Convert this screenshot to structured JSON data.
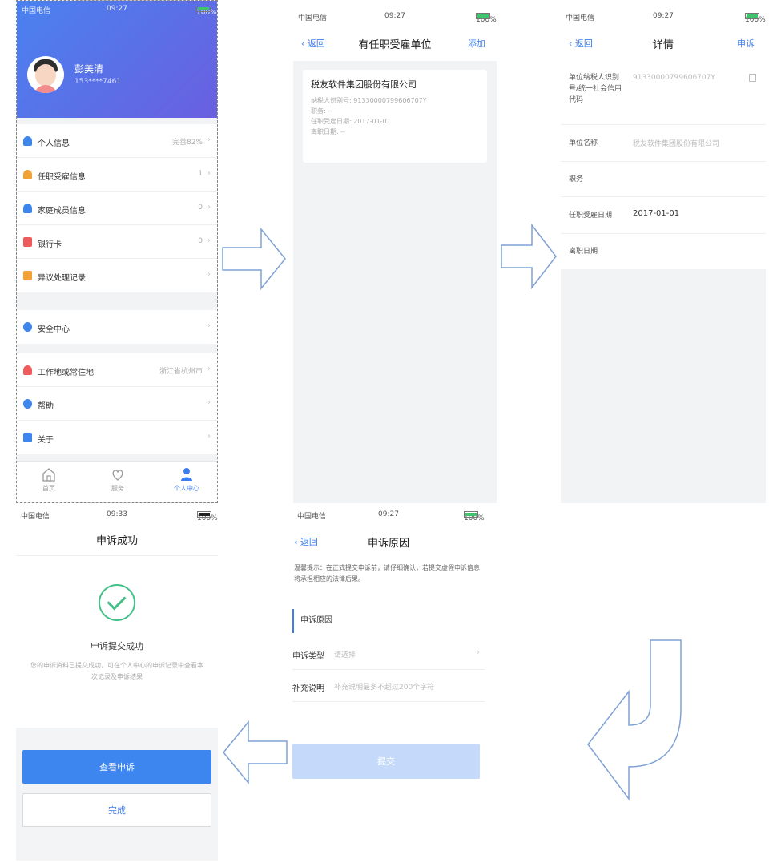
{
  "status_bar": {
    "carrier": "中国电信",
    "time": "09:27",
    "battery": "100%"
  },
  "screen_profile": {
    "user": {
      "name": "彭美清",
      "phone": "153****7461"
    },
    "menu_group_1": [
      {
        "label": "个人信息",
        "value": "完善82%",
        "icon": "person-icon",
        "color": "#3d86f0"
      },
      {
        "label": "任职受雇信息",
        "value": "1",
        "icon": "person-icon",
        "color": "#f2a134"
      },
      {
        "label": "家庭成员信息",
        "value": "0",
        "icon": "person-icon",
        "color": "#3d86f0"
      },
      {
        "label": "银行卡",
        "value": "0",
        "icon": "card-icon",
        "color": "#ef5b5b"
      },
      {
        "label": "异议处理记录",
        "value": "",
        "icon": "record-icon",
        "color": "#f2a134"
      }
    ],
    "menu_group_2": [
      {
        "label": "安全中心",
        "value": "",
        "icon": "shield-icon",
        "color": "#3d86f0"
      }
    ],
    "menu_group_3": [
      {
        "label": "工作地或常住地",
        "value": "浙江省杭州市",
        "icon": "location-icon",
        "color": "#ef5b5b"
      },
      {
        "label": "帮助",
        "value": "",
        "icon": "help-icon",
        "color": "#3d86f0"
      },
      {
        "label": "关于",
        "value": "",
        "icon": "info-icon",
        "color": "#3d86f0"
      }
    ],
    "tabs": [
      {
        "label": "首页"
      },
      {
        "label": "服务"
      },
      {
        "label": "个人中心"
      }
    ]
  },
  "screen_employers": {
    "back": "返回",
    "title": "有任职受雇单位",
    "action": "添加",
    "card": {
      "company": "税友软件集团股份有限公司",
      "taxpayer_id": "纳税人识别号: 91330000799606707Y",
      "position": "职务: --",
      "hire_date": "任职受雇日期: 2017-01-01",
      "leave_date": "离职日期: --"
    }
  },
  "screen_detail": {
    "back": "返回",
    "title": "详情",
    "action": "申诉",
    "rows": [
      {
        "label": "单位纳税人识别号/统一社会信用代码",
        "value": "91330000799606707Y"
      },
      {
        "label": "单位名称",
        "value": "税友软件集团股份有限公司"
      },
      {
        "label": "职务",
        "value": ""
      },
      {
        "label": "任职受雇日期",
        "value": "2017-01-01"
      },
      {
        "label": "离职日期",
        "value": ""
      }
    ]
  },
  "screen_success": {
    "status_time": "09:33",
    "title": "申诉成功",
    "heading": "申诉提交成功",
    "description": "您的申诉资料已提交成功，可在个人中心的申诉记录中查看本次记录及申诉结果",
    "primary_button": "查看申诉",
    "secondary_button": "完成"
  },
  "screen_appeal": {
    "back": "返回",
    "title": "申诉原因",
    "tip": "温馨提示：在正式提交申诉前，请仔细确认，若提交虚假申诉信息将承担相应的法律后果。",
    "section": "申诉原因",
    "type_label": "申诉类型",
    "type_placeholder": "请选择",
    "note_label": "补充说明",
    "note_placeholder": "补充说明最多不超过200个字符",
    "submit": "提交"
  },
  "colors": {
    "accent": "#3d7ef0",
    "success": "#44c089",
    "arrow_stroke": "#7fa2d6"
  }
}
